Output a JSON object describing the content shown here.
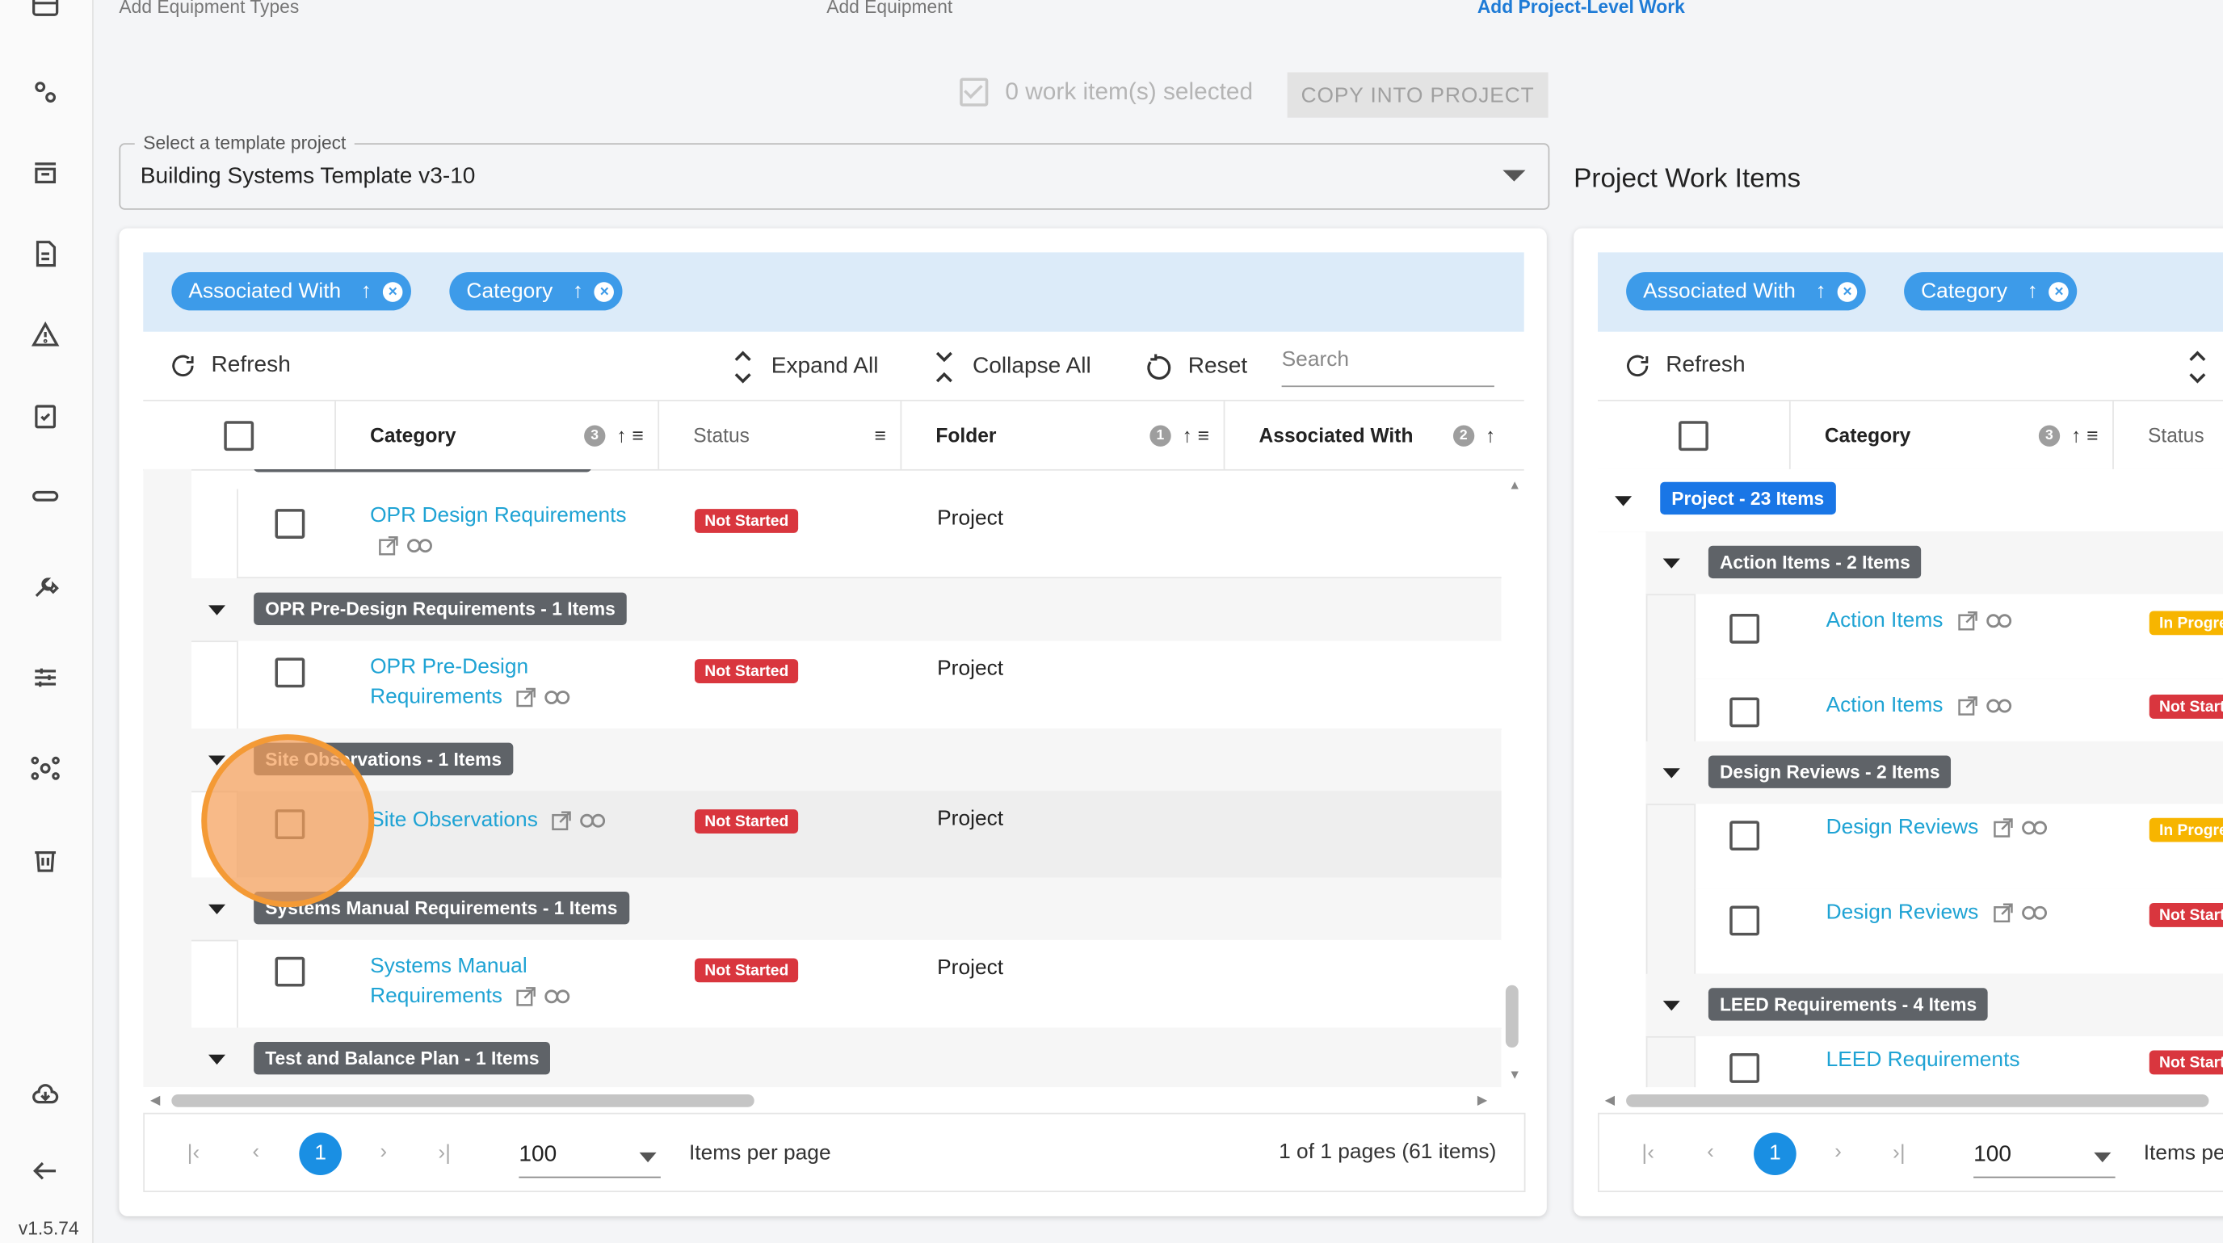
{
  "steps": [
    "Add Equipment Types",
    "Add Equipment",
    "Add Project-Level Work"
  ],
  "version": "v1.5.74",
  "selection": {
    "text": "0 work item(s) selected",
    "copy_button": "COPY INTO PROJECT"
  },
  "template_select": {
    "label": "Select a template project",
    "value": "Building Systems Template v3-10"
  },
  "right_title": "Project Work Items",
  "left_panel": {
    "chips": [
      {
        "label": "Associated With"
      },
      {
        "label": "Category"
      }
    ],
    "toolbar": {
      "refresh": "Refresh",
      "expand": "Expand All",
      "collapse": "Collapse All",
      "reset": "Reset",
      "search_placeholder": "Search"
    },
    "columns": {
      "category": "Category",
      "category_badge": "3",
      "status": "Status",
      "folder": "Folder",
      "folder_badge": "1",
      "associated": "Associated With",
      "associated_badge": "2"
    },
    "rows": [
      {
        "name": "OPR Design Requirements",
        "status": "Not Started",
        "folder": "Project"
      },
      {
        "group": "OPR Pre-Design Requirements - 1 Items"
      },
      {
        "name_line1": "OPR Pre-Design",
        "name_line2": "Requirements",
        "status": "Not Started",
        "folder": "Project"
      },
      {
        "group": "Site Observations - 1 Items"
      },
      {
        "name": "Site Observations",
        "status": "Not Started",
        "folder": "Project"
      },
      {
        "group": "Systems Manual Requirements - 1 Items"
      },
      {
        "name_line1": "Systems Manual",
        "name_line2": "Requirements",
        "status": "Not Started",
        "folder": "Project"
      },
      {
        "group": "Test and Balance Plan - 1 Items"
      }
    ],
    "pager": {
      "page": "1",
      "size": "100",
      "per_page": "Items per page",
      "summary": "1 of 1 pages (61 items)"
    }
  },
  "right_panel": {
    "chips": [
      {
        "label": "Associated With"
      },
      {
        "label": "Category"
      }
    ],
    "toolbar": {
      "refresh": "Refresh"
    },
    "columns": {
      "category": "Category",
      "category_badge": "3",
      "status": "Status"
    },
    "root_group": "Project - 23 Items",
    "groups": [
      {
        "label": "Action Items - 2 Items",
        "items": [
          {
            "name": "Action Items",
            "status": "In Progre"
          },
          {
            "name": "Action Items",
            "status": "Not Start"
          }
        ]
      },
      {
        "label": "Design Reviews - 2 Items",
        "items": [
          {
            "name": "Design Reviews",
            "status": "In Progre"
          },
          {
            "name": "Design Reviews",
            "status": "Not Start"
          }
        ]
      },
      {
        "label": "LEED Requirements - 4 Items",
        "items": [
          {
            "name": "LEED Requirements",
            "status": "Not Start"
          }
        ]
      }
    ],
    "pager": {
      "page": "1",
      "size": "100",
      "per_page": "Items pe"
    }
  },
  "colors": {
    "accent": "#1a8fe3",
    "chip": "#3d9be9",
    "link": "#1fa3d4",
    "not_started": "#d9363e",
    "in_progress": "#f7b500",
    "group_tag": "#5f6368",
    "click_indicator": "#f49a35"
  }
}
